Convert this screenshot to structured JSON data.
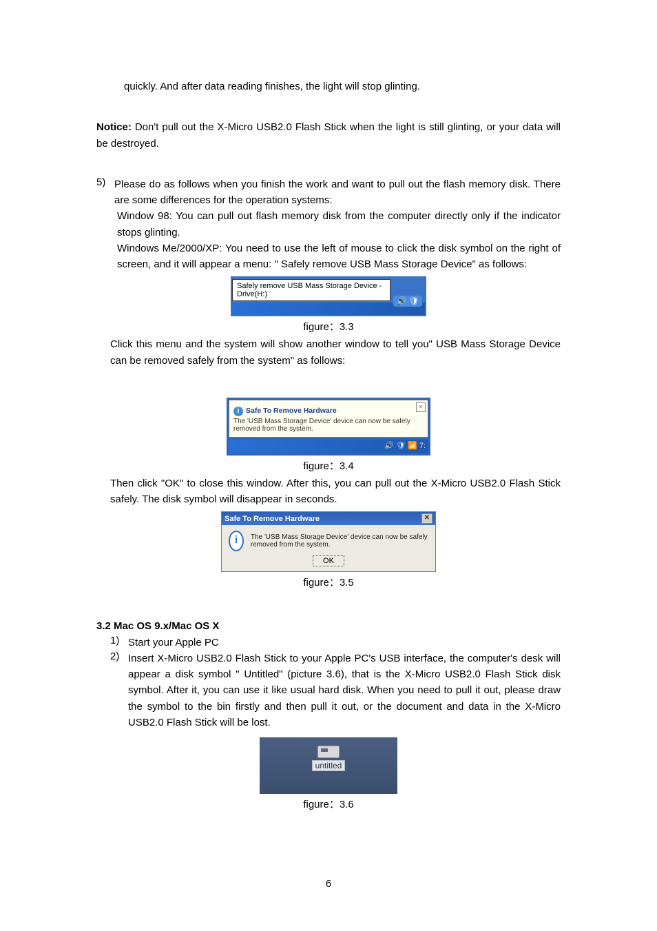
{
  "topline": "quickly. And after data reading finishes, the light will stop glinting.",
  "notice_label": "Notice:",
  "notice_text": " Don't pull out the X-Micro USB2.0 Flash Stick when the light is still glinting, or your data will be destroyed.",
  "item5": {
    "num": "5)",
    "p1": "Please do as follows when you finish the work and want to pull out the flash memory disk. There are some differences for the operation systems:",
    "p2": "Window 98: You can pull out flash memory disk from the computer directly only if the indicator stops glinting.",
    "p3": "Windows Me/2000/XP: You need to use the left of mouse to click the disk symbol on the right of screen, and it will appear a menu: \" Safely remove USB Mass Storage Device\" as follows:"
  },
  "fig33": {
    "tooltip": "Safely remove USB Mass Storage Device - Drive(H:)",
    "caption": "figure：3.3"
  },
  "after33": "Click this menu and the system will show another window to tell you\" USB Mass Storage Device can be removed safely from the system\" as follows:",
  "fig34": {
    "title": "Safe To Remove Hardware",
    "body": "The 'USB Mass Storage Device' device can now be safely removed from the system.",
    "caption": "figure：3.4"
  },
  "after34": "Then click \"OK\" to close this window. After this, you can pull out the X-Micro USB2.0 Flash Stick safely. The disk symbol will disappear in seconds.",
  "fig35": {
    "title": "Safe To Remove Hardware",
    "msg": "The 'USB Mass Storage Device' device can now be safely removed from the system.",
    "ok": "OK",
    "caption": "figure：3.5"
  },
  "sec32_heading": "3.2 Mac OS 9.x/Mac OS X",
  "item1": {
    "num": "1)",
    "text": "Start your Apple PC"
  },
  "item2": {
    "num": "2)",
    "text": "Insert X-Micro USB2.0 Flash Stick to your Apple PC's USB interface, the computer's desk will appear a disk symbol \" Untitled\" (picture 3.6), that is the X-Micro USB2.0 Flash Stick disk symbol. After it, you can use it like usual hard disk. When you need to pull it out, please draw the symbol to the bin firstly and then pull it out, or the document and data in the X-Micro USB2.0 Flash Stick will be lost."
  },
  "fig36": {
    "label": "untitled",
    "caption": "figure：3.6"
  },
  "page_number": "6"
}
